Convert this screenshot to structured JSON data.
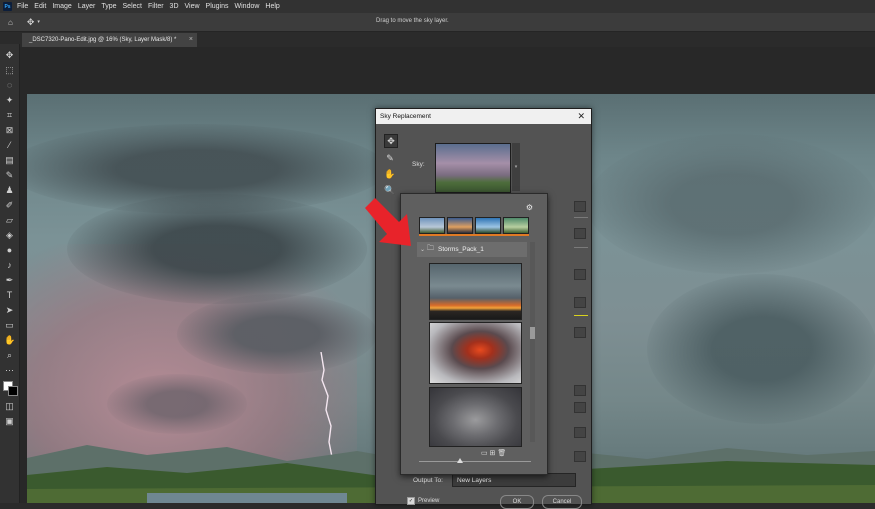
{
  "app": {
    "logo": "Ps"
  },
  "menu": [
    "File",
    "Edit",
    "Image",
    "Layer",
    "Type",
    "Select",
    "Filter",
    "3D",
    "View",
    "Plugins",
    "Window",
    "Help"
  ],
  "options_bar": {
    "hint": "Drag to move the sky layer."
  },
  "document": {
    "tab_title": "_DSC7320-Pano-Edit.jpg @ 16% (Sky, Layer Mask/8) *",
    "close": "×"
  },
  "dialog": {
    "title": "Sky Replacement",
    "close": "✕",
    "sky_label": "Sky:",
    "output_label": "Output To:",
    "output_value": "New Layers",
    "preview_label": "Preview",
    "ok_label": "OK",
    "cancel_label": "Cancel",
    "tools": [
      {
        "icon": "move-icon",
        "glyph": "✥"
      },
      {
        "icon": "sky-brush-icon",
        "glyph": "✎"
      },
      {
        "icon": "hand-icon",
        "glyph": "✋"
      },
      {
        "icon": "zoom-icon",
        "glyph": "🔍"
      }
    ]
  },
  "picker": {
    "gear": "⚙",
    "folder_name": "Storms_Pack_1",
    "footer_icons": "▭ ⊞ 🗑"
  },
  "colors": {
    "annotation_arrow": "#e8232a",
    "accent_yellow": "#d8d21e"
  }
}
